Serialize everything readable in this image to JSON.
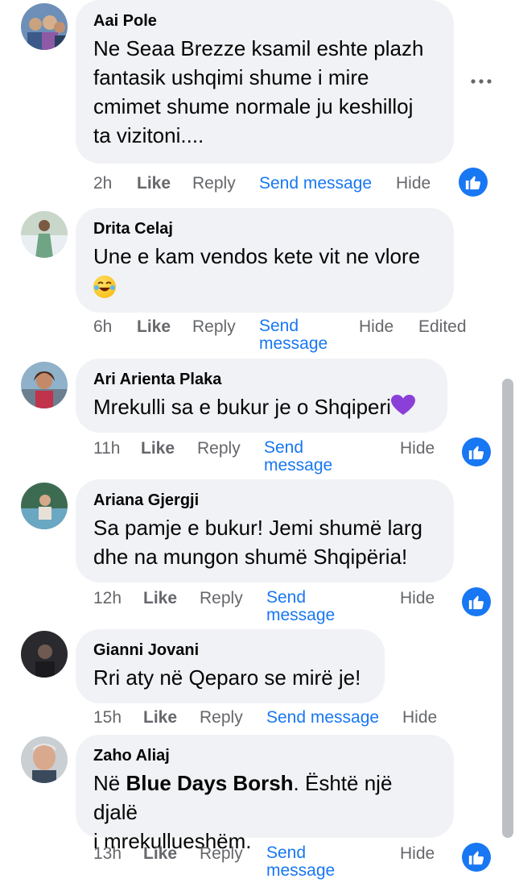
{
  "comments": [
    {
      "author": "Aai Pole",
      "lines": [
        "Ne Seaa Brezze ksamil eshte plazh",
        "fantasik ushqimi shume i mire",
        "cmimet shume normale ju keshilloj",
        "ta vizitoni...."
      ],
      "time": "2h",
      "like": "Like",
      "reply": "Reply",
      "send": "Send message",
      "hide": "Hide"
    },
    {
      "author": "Drita Celaj",
      "lines": [
        "Une e kam vendos kete vit ne vlore"
      ],
      "time": "6h",
      "like": "Like",
      "reply": "Reply",
      "send1": "Send",
      "send2": "message",
      "hide": "Hide",
      "edited": "Edited"
    },
    {
      "author": "Ari Arienta Plaka",
      "lines": [
        "Mrekulli sa e bukur je o Shqiperi"
      ],
      "time": "11h",
      "like": "Like",
      "reply": "Reply",
      "send1": "Send",
      "send2": "message",
      "hide": "Hide"
    },
    {
      "author": "Ariana Gjergji",
      "lines": [
        "Sa pamje e bukur! Jemi shumë larg",
        "dhe na mungon shumë Shqipëria!"
      ],
      "time": "12h",
      "like": "Like",
      "reply": "Reply",
      "send1": "Send",
      "send2": "message",
      "hide": "Hide"
    },
    {
      "author": "Gianni Jovani",
      "lines": [
        "Rri aty në Qeparo se mirë je!"
      ],
      "time": "15h",
      "like": "Like",
      "reply": "Reply",
      "send": "Send message",
      "hide": "Hide"
    },
    {
      "author": "Zaho Aliaj",
      "line1_prefix": "Në ",
      "line1_bold": "Blue Days Borsh",
      "line1_suffix": ". Është një djalë",
      "line2": "i mrekullueshëm.",
      "time": "13h",
      "like": "Like",
      "reply": "Reply",
      "send1": "Send",
      "send2": "message",
      "hide": "Hide"
    }
  ],
  "icons": {
    "more": "more-options-icon",
    "like_badge": "like-reaction-icon",
    "laugh": "laughing-emoji-icon",
    "heart": "purple-heart-icon"
  },
  "colors": {
    "bubble": "#f0f2f5",
    "link": "#1877f2",
    "secondary": "#65676b",
    "heart": "#8b3fd9"
  }
}
